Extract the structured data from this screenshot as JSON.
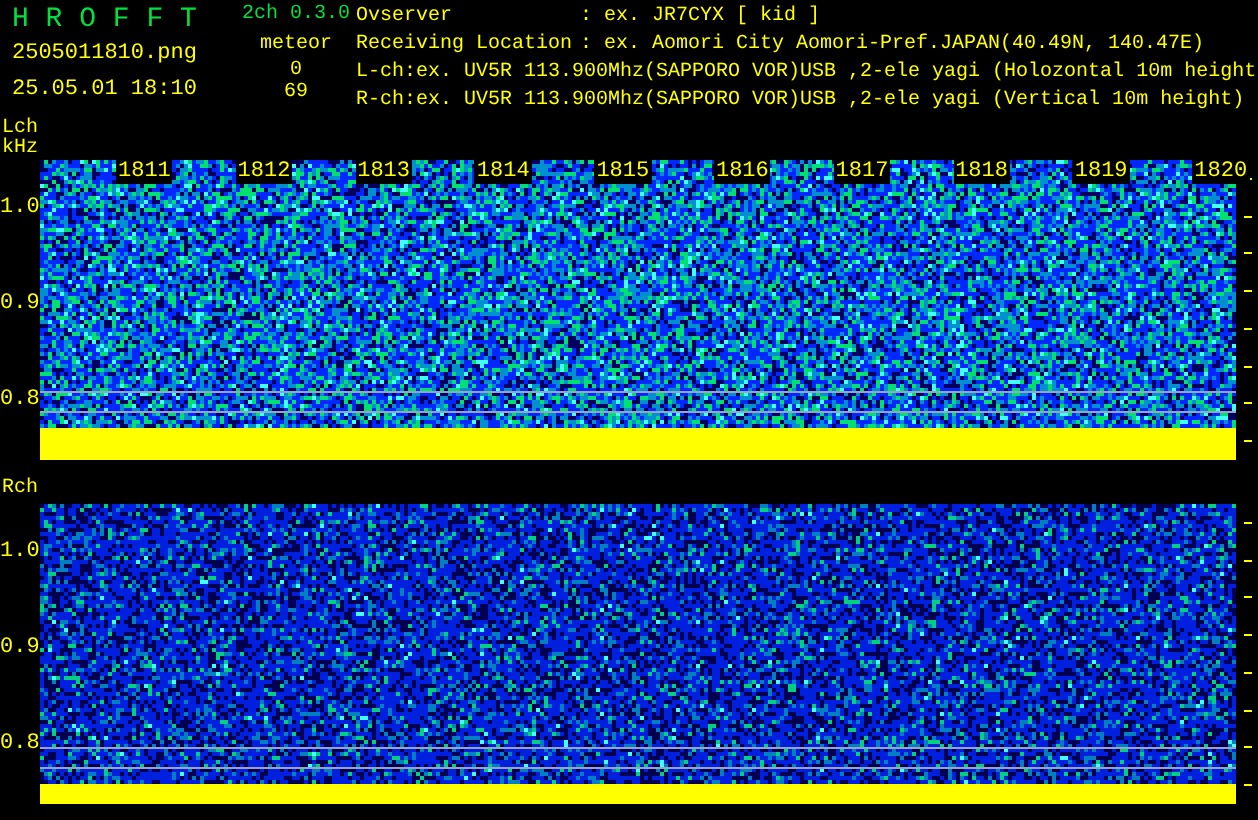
{
  "app": {
    "name": "H R O F F T",
    "version": "2ch 0.3.0"
  },
  "file": {
    "name": "2505011810.png",
    "datetime": "25.05.01 18:10"
  },
  "meteor": {
    "label": "meteor",
    "counts": [
      "0",
      "69"
    ]
  },
  "fields": [
    {
      "label": "Ovserver",
      "value": ": ex. JR7CYX [ kid ]"
    },
    {
      "label": "Receiving Location",
      "value": ": ex. Aomori City Aomori-Pref.JAPAN(40.49N, 140.47E)"
    }
  ],
  "channel_lines": [
    "L-ch:ex. UV5R 113.900Mhz(SAPPORO VOR)USB ,2-ele yagi (Holozontal 10m height",
    "R-ch:ex. UV5R 113.900Mhz(SAPPORO VOR)USB ,2-ele yagi (Vertical 10m height)"
  ],
  "panels": [
    {
      "label": "Lch",
      "unit": "kHz",
      "times": [
        "1811",
        "1812",
        "1813",
        "1814",
        "1815",
        "1816",
        "1817",
        "1818",
        "1819",
        "1820"
      ],
      "yticks": [
        "1.0",
        "0.9",
        "0.8"
      ]
    },
    {
      "label": "Rch",
      "yticks": [
        "1.0",
        "0.9",
        "0.8"
      ]
    }
  ]
}
